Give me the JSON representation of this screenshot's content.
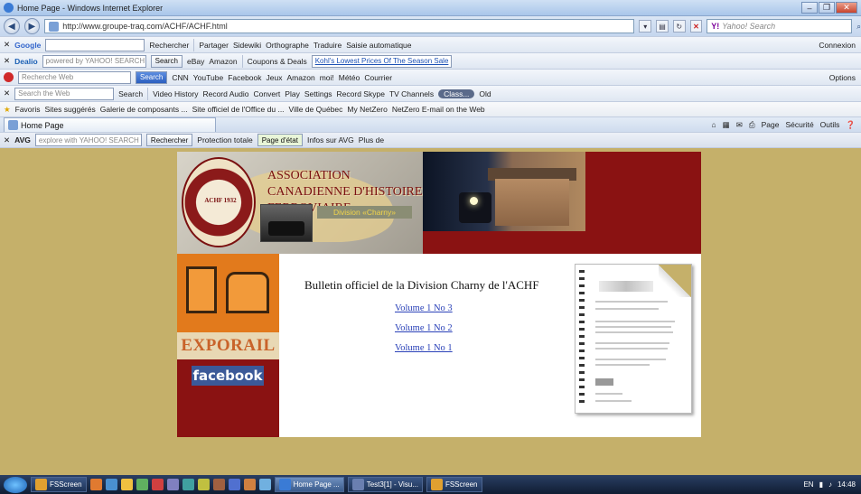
{
  "window": {
    "title": "Home Page - Windows Internet Explorer",
    "url": "http://www.groupe-traq.com/ACHF/ACHF.html",
    "search_placeholder": "Yahoo! Search"
  },
  "toolbars": {
    "google": {
      "brand": "Google",
      "items": [
        "Rechercher",
        "Partager",
        "Sidewiki",
        "Orthographe",
        "Traduire",
        "Saisie automatique"
      ],
      "right": "Connexion"
    },
    "dealio": {
      "brand": "Dealio",
      "search_placeholder": "powered by YAHOO! SEARCH",
      "search_button": "Search",
      "items": [
        "eBay",
        "Amazon",
        "Coupons & Deals",
        "Kohl's Lowest Prices Of The Season Sale"
      ]
    },
    "ask": {
      "search_placeholder": "Recherche Web",
      "search_button": "Search",
      "items": [
        "CNN",
        "YouTube",
        "Facebook",
        "Jeux",
        "Amazon",
        "moi!",
        "Météo",
        "Courrier"
      ],
      "right": "Options"
    },
    "video": {
      "search_placeholder": "Search the Web",
      "search_button": "Search",
      "items": [
        "Video History",
        "Record Audio",
        "Convert",
        "Play",
        "Settings",
        "Record Skype",
        "TV Channels",
        "Class...",
        "Old"
      ]
    },
    "favorites": {
      "label": "Favoris",
      "items": [
        "Sites suggérés",
        "Galerie de composants ...",
        "Site officiel de l'Office du ...",
        "Ville de Québec",
        "My NetZero",
        "NetZero E-mail on the Web"
      ]
    },
    "tabs": {
      "active_tab": "Home Page",
      "commands": [
        "Page",
        "Sécurité",
        "Outils"
      ]
    },
    "avg": {
      "brand": "AVG",
      "search_placeholder": "explore with YAHOO! SEARCH",
      "items": [
        "Rechercher",
        "Protection totale",
        "Page d'état",
        "Infos sur AVG",
        "Plus de"
      ]
    }
  },
  "site": {
    "association_title": "ASSOCIATION CANADIENNE D'HISTOIRE FERROVIAIRE",
    "division": "Division «Charny»",
    "seal_text": "ACHF 1932",
    "exporail": "EXPORAIL",
    "facebook": "facebook",
    "bulletin_title": "Bulletin officiel de la Division Charny de l'ACHF",
    "volumes": [
      "Volume 1 No 3",
      "Volume 1 No 2",
      "Volume 1 No 1"
    ]
  },
  "taskbar": {
    "tasks": [
      "FSScreen",
      "Home Page ...",
      "Test3[1] - Visu...",
      "FSScreen"
    ],
    "tray_lang": "EN",
    "clock": "14:48"
  },
  "colors": {
    "page_bg": "#c5b06a",
    "banner_red": "#8a1212",
    "link_blue": "#2a41b8",
    "facebook_blue": "#3b5998"
  }
}
